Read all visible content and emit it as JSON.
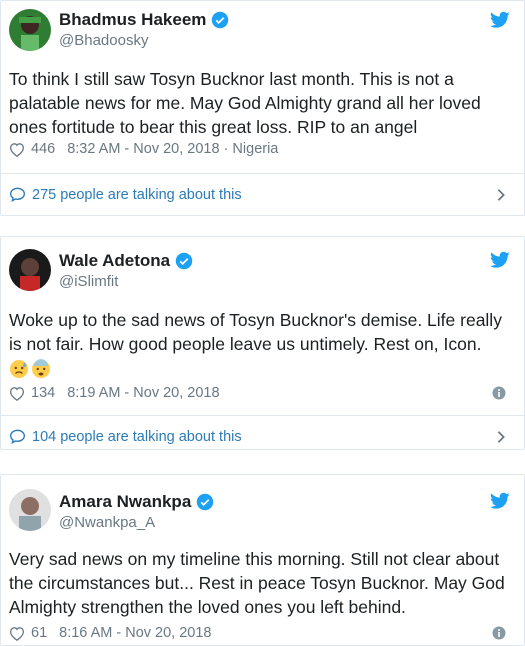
{
  "colors": {
    "accent": "#1da1f2",
    "link": "#2b7bb9",
    "muted": "#697882",
    "border": "#e1e8ed"
  },
  "tweets": [
    {
      "name": "Bhadmus Hakeem",
      "handle": "@Bhadoosky",
      "text": "To think I still saw Tosyn Bucknor last month. This is not a palatable news for me. May God Almighty grand all her loved ones fortitude to bear this great loss. RIP to an angel",
      "likes": "446",
      "timestamp": "8:32 AM - Nov 20, 2018 · Nigeria",
      "talking": "275 people are talking about this"
    },
    {
      "name": "Wale Adetona",
      "handle": "@iSlimfit",
      "text": "Woke up to the sad news of Tosyn Bucknor's demise. Life really is not fair. How good people leave us untimely. Rest on, Icon.",
      "emojis": [
        "sad-sweat-emoji",
        "fearful-emoji"
      ],
      "likes": "134",
      "timestamp": "8:19 AM - Nov 20, 2018",
      "talking": "104 people are talking about this"
    },
    {
      "name": "Amara Nwankpa",
      "handle": "@Nwankpa_A",
      "text": "Very sad news on my timeline this morning. Still not clear about the circumstances but... Rest in peace Tosyn Bucknor. May God Almighty strengthen the loved ones you left behind.",
      "likes": "61",
      "timestamp": "8:16 AM - Nov 20, 2018"
    }
  ]
}
